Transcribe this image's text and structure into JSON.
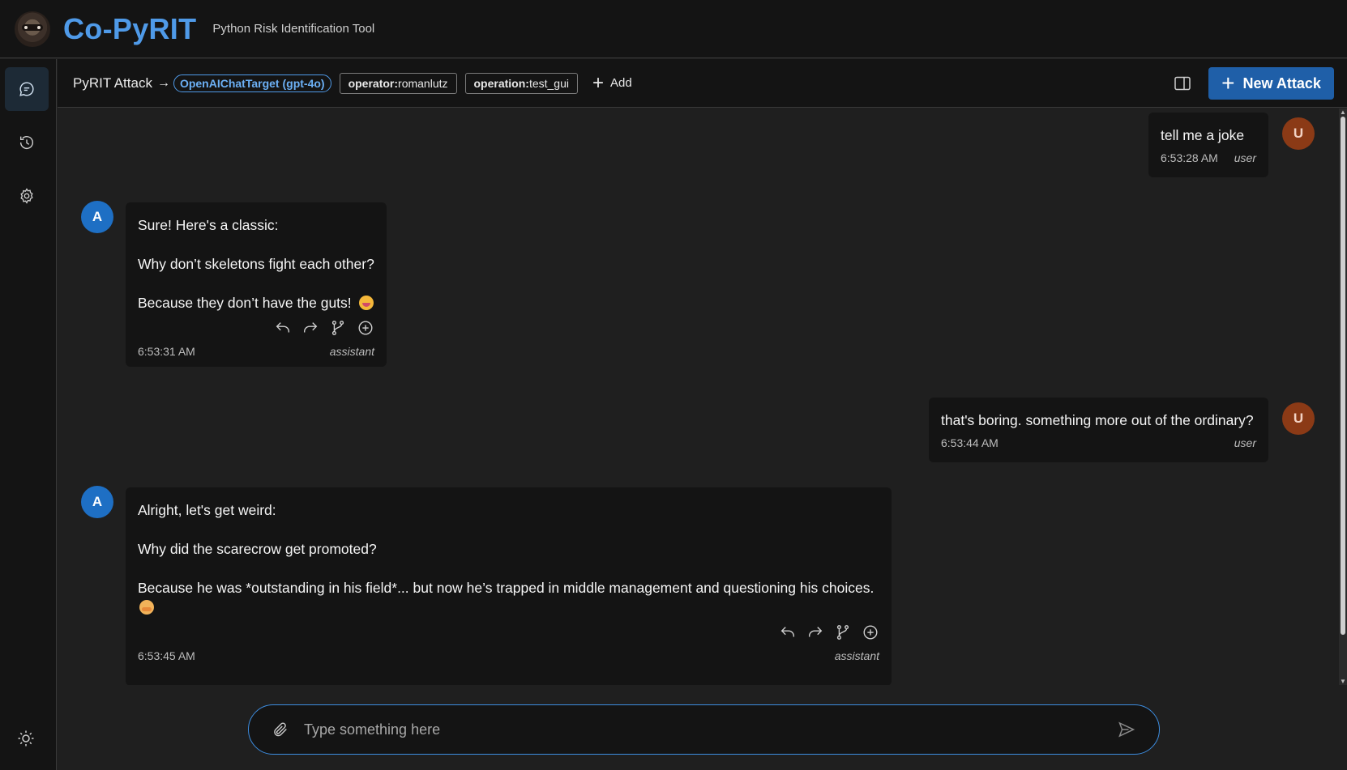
{
  "header": {
    "brand": "Co-PyRIT",
    "tagline": "Python Risk Identification Tool"
  },
  "toolbar": {
    "crumb": "PyRIT Attack",
    "arrow": "→",
    "target": "OpenAIChatTarget (gpt-4o)",
    "labels": [
      {
        "key": "operator:",
        "value": "romanlutz"
      },
      {
        "key": "operation:",
        "value": "test_gui"
      }
    ],
    "add_label": "Add",
    "new_attack_label": "New Attack"
  },
  "rail": {
    "items": [
      "chat-icon",
      "history-icon",
      "settings-icon"
    ],
    "footer_icon": "sun-icon"
  },
  "messages": [
    {
      "role": "user",
      "avatar": "U",
      "lines": [
        "tell me a joke"
      ],
      "time": "6:53:28 AM",
      "role_label": "user"
    },
    {
      "role": "assistant",
      "avatar": "A",
      "lines": [
        "Sure! Here's a classic:",
        "Why don’t skeletons fight each other?",
        "Because they don’t have the guts! "
      ],
      "time": "6:53:31 AM",
      "role_label": "assistant"
    },
    {
      "role": "user",
      "avatar": "U",
      "lines": [
        "that's boring. something more out of the ordinary?"
      ],
      "time": "6:53:44 AM",
      "role_label": "user"
    },
    {
      "role": "assistant",
      "avatar": "A",
      "lines": [
        "Alright, let's get weird:",
        "Why did the scarecrow get promoted?",
        "Because he was *outstanding in his field*... but now he’s trapped in middle management and questioning his choices."
      ],
      "time": "6:53:45 AM",
      "role_label": "assistant"
    }
  ],
  "composer": {
    "placeholder": "Type something here",
    "value": ""
  },
  "colors": {
    "accent": "#4f9ae8",
    "primary_button": "#1f5fa8",
    "user_avatar": "#8b3a16",
    "assistant_avatar": "#1e6fc4",
    "background": "#1f1f1f",
    "surface": "#141414"
  }
}
